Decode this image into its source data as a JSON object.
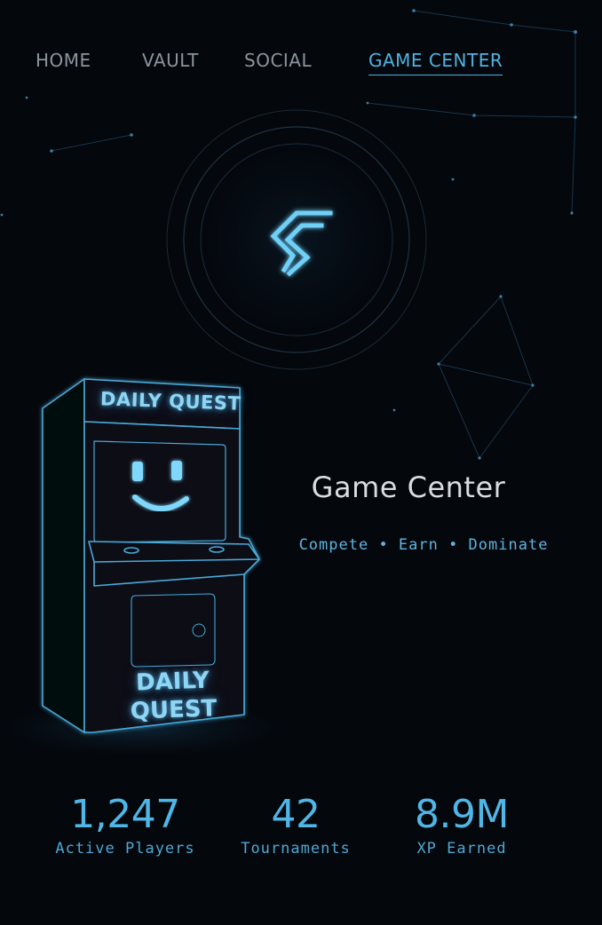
{
  "nav": {
    "items": [
      {
        "label": "HOME",
        "active": false
      },
      {
        "label": "VAULT",
        "active": false
      },
      {
        "label": "SOCIAL",
        "active": false
      },
      {
        "label": "GAME CENTER",
        "active": true
      }
    ]
  },
  "logo": {
    "icon": "brand-s-logo-icon"
  },
  "arcade": {
    "marquee": "DAILY QUEST",
    "panel": "DAILY QUEST",
    "screen_icon": "smiley-face-icon"
  },
  "hero": {
    "title": "Game Center",
    "subtitle": "Compete • Earn • Dominate"
  },
  "stats": [
    {
      "value": "1,247",
      "label": "Active Players"
    },
    {
      "value": "42",
      "label": "Tournaments"
    },
    {
      "value": "8.9M",
      "label": "XP Earned"
    }
  ],
  "colors": {
    "background": "#04070c",
    "accent": "#4fb3e0",
    "nav_inactive": "#8c949c",
    "title": "#d7dde2"
  }
}
